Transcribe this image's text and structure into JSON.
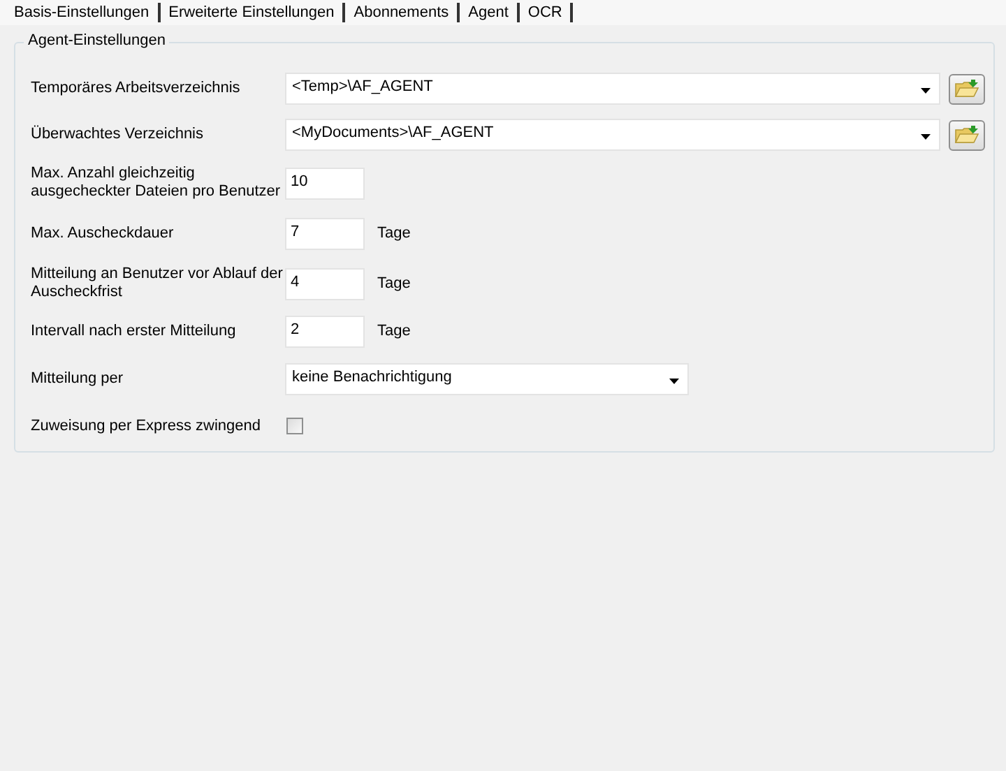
{
  "tabs": [
    {
      "label": "Basis-Einstellungen"
    },
    {
      "label": "Erweiterte Einstellungen"
    },
    {
      "label": "Abonnements"
    },
    {
      "label": "Agent"
    },
    {
      "label": "OCR"
    }
  ],
  "group": {
    "title": "Agent-Einstellungen",
    "rows": [
      {
        "kind": "folder",
        "label": "Temporäres Arbeitsverzeichnis",
        "value": "<Temp>\\AF_AGENT"
      },
      {
        "kind": "folder",
        "label": "Überwachtes Verzeichnis",
        "value": "<MyDocuments>\\AF_AGENT"
      },
      {
        "kind": "text",
        "label": "Max. Anzahl gleichzeitig ausgecheckter Dateien pro Benutzer",
        "value": "10"
      },
      {
        "kind": "text",
        "label": "Max. Auscheckdauer",
        "value": "7",
        "unit": "Tage"
      },
      {
        "kind": "text",
        "label": "Mitteilung an Benutzer vor Ablauf der Auscheckfrist",
        "value": "4",
        "unit": "Tage"
      },
      {
        "kind": "text",
        "label": "Intervall nach erster Mitteilung",
        "value": "2",
        "unit": "Tage"
      },
      {
        "kind": "combo",
        "label": "Mitteilung per",
        "value": "keine Benachrichtigung"
      },
      {
        "kind": "checkbox",
        "label": "Zuweisung per Express zwingend",
        "checked": false
      }
    ]
  }
}
